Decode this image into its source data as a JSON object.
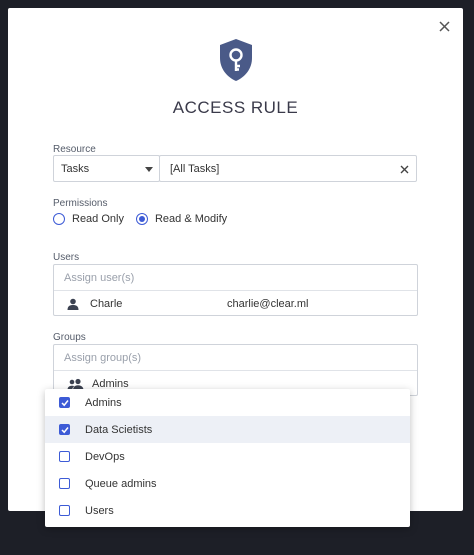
{
  "dialog": {
    "title": "ACCESS RULE",
    "close_icon": "close-icon",
    "shield_icon": "shield-key-icon"
  },
  "colors": {
    "accent": "#3d5bd6",
    "shield": "#4a5a88",
    "backdrop": "#1d1f27"
  },
  "resource": {
    "label": "Resource",
    "type_value": "Tasks",
    "target_value": "[All Tasks]"
  },
  "permissions": {
    "label": "Permissions",
    "options": [
      {
        "label": "Read Only",
        "selected": false
      },
      {
        "label": "Read & Modify",
        "selected": true
      }
    ]
  },
  "users": {
    "label": "Users",
    "placeholder": "Assign user(s)",
    "items": [
      {
        "name": "Charle",
        "email": "charlie@clear.ml"
      }
    ]
  },
  "groups": {
    "label": "Groups",
    "placeholder": "Assign group(s)",
    "items": [
      {
        "name": "Admins"
      }
    ],
    "dropdown": [
      {
        "label": "Admins",
        "checked": true
      },
      {
        "label": "Data Scietists",
        "checked": true
      },
      {
        "label": "DevOps",
        "checked": false
      },
      {
        "label": "Queue admins",
        "checked": false
      },
      {
        "label": "Users",
        "checked": false
      }
    ]
  }
}
